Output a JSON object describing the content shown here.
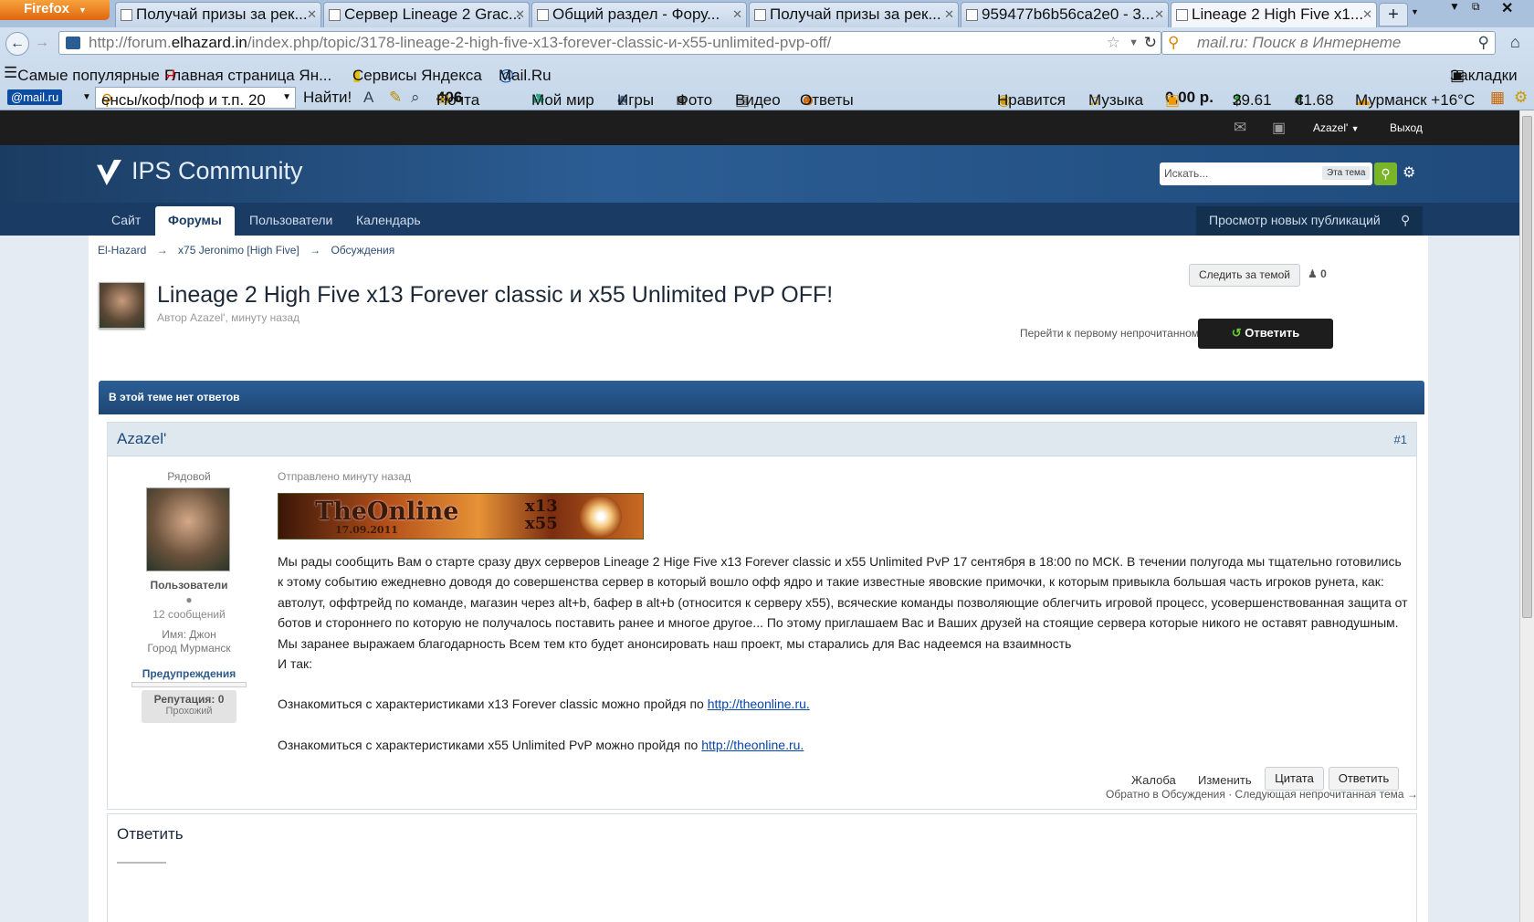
{
  "browser": {
    "app_button": "Firefox",
    "tabs": [
      {
        "label": "Получай призы за рек..."
      },
      {
        "label": "Сервер Lineage 2 Grac..."
      },
      {
        "label": "Общий раздел - Фору..."
      },
      {
        "label": "Получай призы за рек..."
      },
      {
        "label": "959477b6b56ca2e0 - 3..."
      },
      {
        "label": "Lineage 2 High Five x1..."
      }
    ],
    "url_host_prefix": "http://forum.",
    "url_host": "elhazard.in",
    "url_path": "/index.php/topic/3178-lineage-2-high-five-x13-forever-classic-и-x55-unlimited-pvp-off/",
    "search_placeholder": "mail.ru: Поиск в Интернете",
    "bookmarks": [
      "Самые популярные",
      "Главная страница Ян...",
      "Сервисы Яндекса",
      "Mail.Ru"
    ],
    "bookmarks_menu": "Закладки",
    "mailbar": {
      "logo": "@mail.ru",
      "search_value": "енсы/коф/поф и т.п. 20",
      "find": "Найти!",
      "mail": "Почта",
      "mail_count": "406",
      "myworld": "Мой мир",
      "games": "Игры",
      "photo": "Фото",
      "video": "Видео",
      "answers": "Ответы",
      "likes": "Нравится",
      "music": "Музыка",
      "balance": "0,00 р.",
      "usd": "29.61",
      "eur": "41.68",
      "weather": "Мурманск +16°C"
    }
  },
  "forum": {
    "user": "Azazel'",
    "logout": "Выход",
    "logo_text": "IPS Community",
    "search_placeholder": "Искать...",
    "search_scope": "Эта тема",
    "nav": [
      "Сайт",
      "Форумы",
      "Пользователи",
      "Календарь"
    ],
    "new_posts": "Просмотр новых публикаций",
    "breadcrumb": [
      "El-Hazard",
      "x75 Jeronimo [High Five]",
      "Обсуждения"
    ],
    "topic_title": "Lineage 2 High Five x13 Forever classic и x55 Unlimited PvP OFF!",
    "topic_meta": "Автор Azazel', минуту назад",
    "follow": "Следить за темой",
    "followers": "0",
    "first_unread": "Перейти к первому непрочитанному сообщению",
    "reply_button": "Ответить",
    "notice": "В этой теме нет ответов",
    "post": {
      "author": "Azazel'",
      "number": "#1",
      "rank": "Рядовой",
      "group": "Пользователи",
      "post_count": "12 сообщений",
      "name_label": "Имя:",
      "name_value": "Джон",
      "city_label": "Город",
      "city_value": "Мурманск",
      "warnings": "Предупреждения",
      "reputation": "Репутация: 0",
      "reputation_level": "Прохожий",
      "sent": "Отправлено минуту назад",
      "banner_title": "TheOnline",
      "banner_date": "17.09.2011",
      "banner_rates": "x13\nx55",
      "body": "Мы рады сообщить Вам о старте сразу двух серверов Lineage 2 Hige Five x13 Forever classic и x55 Unlimited PvP 17 сентября в 18:00 по МСК. В течении полугода мы тщательно готовились к этому событию ежедневно доводя до совершенства сервер в который вошло офф ядро и такие известные явовские примочки, к которым привыкла большая часть игроков рунета, как: автолут, оффтрейд по команде, магазин через alt+b, бафер в alt+b (относится к серверу x55), всяческие команды позволяющие облегчить игровой процесс, усовершенствованная защита от ботов и стороннего по которую не получалось поставить ранее и многое другое... По этому приглашаем Вас и Ваших друзей на стоящие сервера которые никого не оставят равнодушным. Мы заранее выражаем благодарность Всем тем кто будет анонсировать наш проект, мы старались для Вас надеемся на взаимность",
      "and_so": "И так:",
      "line1": "Ознакомиться с характеристиками x13 Forever classic можно пройдя по",
      "line2": "Ознакомиться с характеристиками x55 Unlimited PvP можно пройдя по",
      "link": "http://theonline.ru.",
      "report": "Жалоба",
      "edit": "Изменить",
      "quote": "Цитата",
      "reply": "Ответить"
    },
    "back_link": "Обратно в Обсуждения",
    "next_unread": "Следующая непрочитанная тема →",
    "reply_section": "Ответить"
  },
  "colors": {
    "header_blue": "#2b5d94",
    "nav_blue": "#1a3b63",
    "firefox_orange": "#e0660f"
  }
}
